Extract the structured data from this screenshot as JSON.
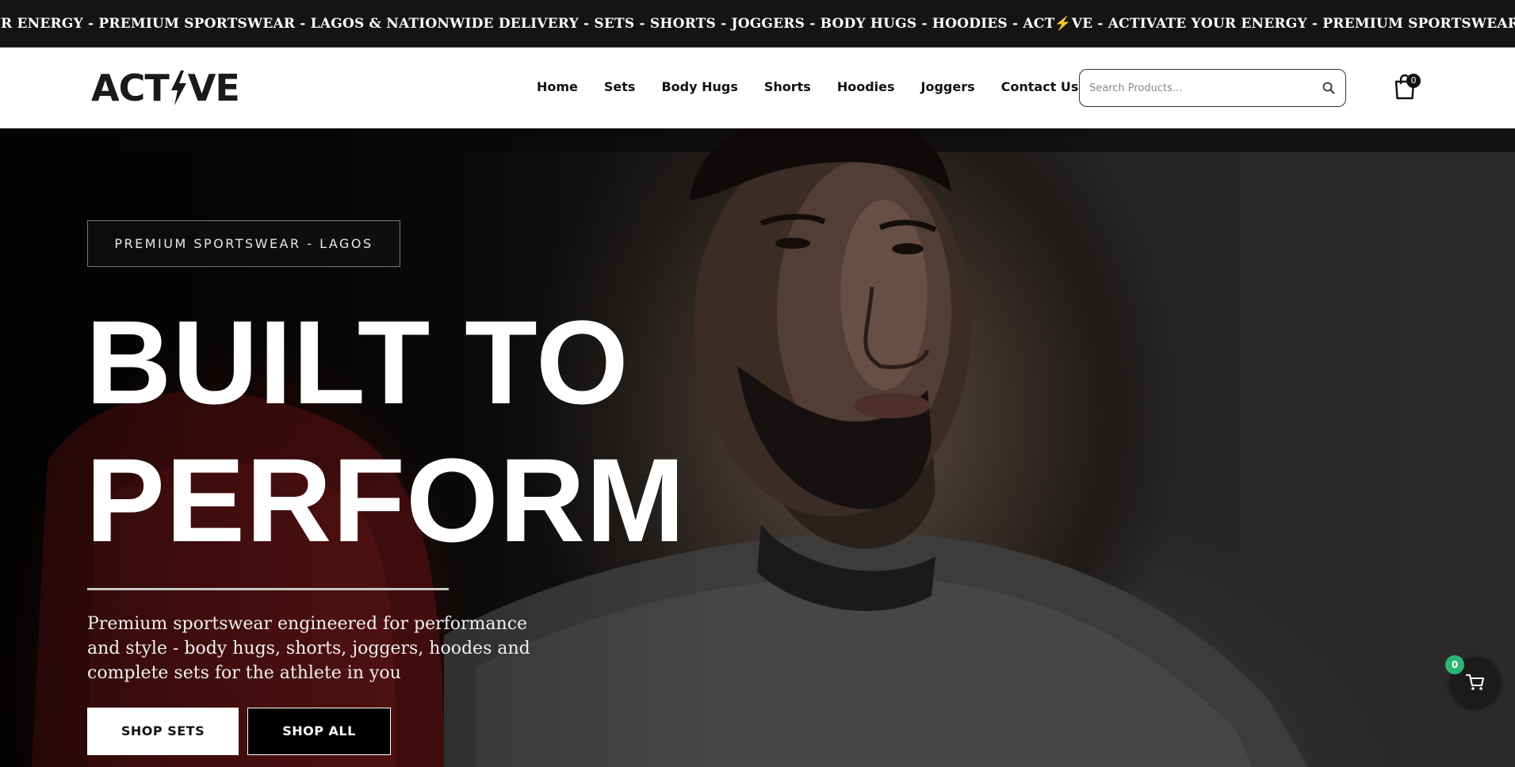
{
  "ticker": {
    "text_before_bolt": "UR ENERGY - PREMIUM SPORTSWEAR - LAGOS & NATIONWIDE DELIVERY - SETS - SHORTS - JOGGERS - BODY HUGS - HOODIES - ACT",
    "bolt": "⚡",
    "text_after_bolt": "VE - ACTIVATE YOUR ENERGY - PREMIUM SPORTSWEAR - LAGOS & NATIONWIDE DELIVERY - SETS"
  },
  "header": {
    "logo_left": "ACT",
    "logo_right": "VE",
    "nav": [
      "Home",
      "Sets",
      "Body Hugs",
      "Shorts",
      "Hoodies",
      "Joggers",
      "Contact Us"
    ],
    "search_placeholder": "Search Products...",
    "cart_count": "0"
  },
  "hero": {
    "badge": "PREMIUM SPORTSWEAR - LAGOS",
    "headline_line1": "BUILT TO",
    "headline_line2": "PERFORM",
    "subtext": "Premium sportswear engineered for performance and style - body hugs, shorts, joggers, hoodes and complete sets for the athlete in you",
    "btn_primary": "SHOP SETS",
    "btn_secondary": "SHOP ALL"
  },
  "floating_cart": {
    "count": "0"
  },
  "icons": {
    "search": "search-icon",
    "cart": "shopping-bag-icon",
    "floating_cart": "shopping-cart-icon",
    "logo_bolt": "lightning-bolt-icon"
  },
  "colors": {
    "ticker_bg": "#141414",
    "header_bg": "#ffffff",
    "accent_green": "#2bb673",
    "bolt": "#f5a623"
  }
}
